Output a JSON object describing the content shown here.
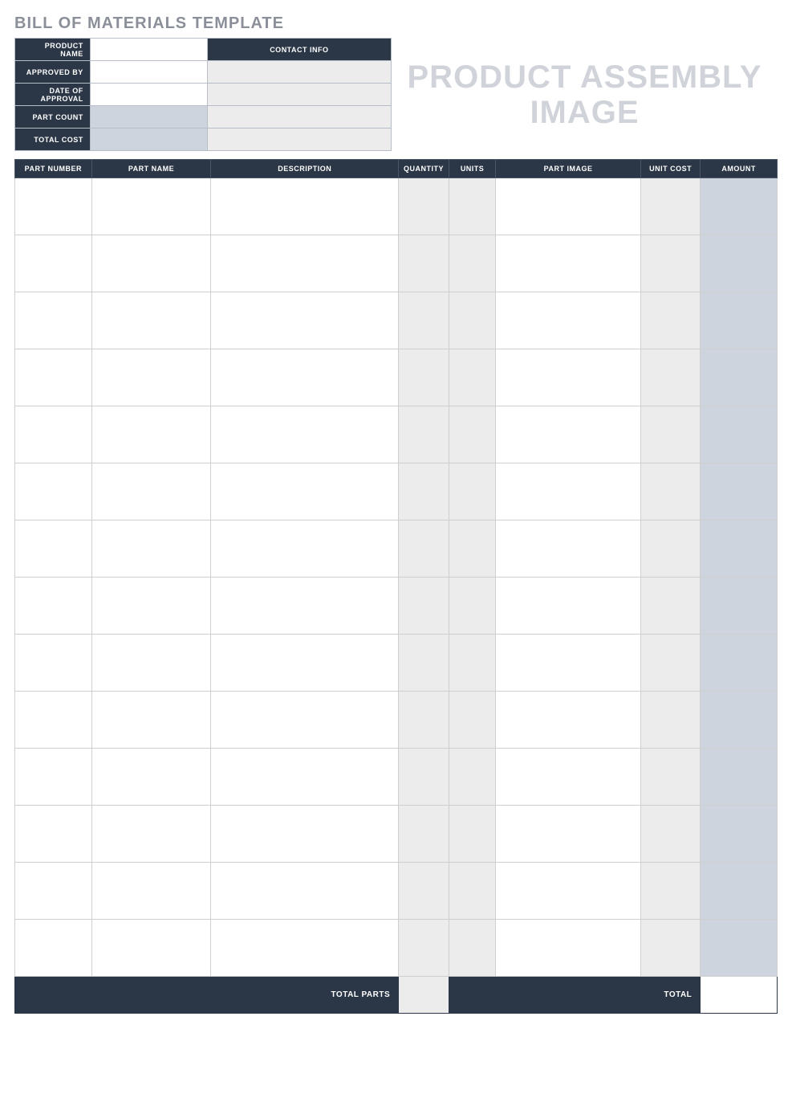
{
  "title": "BILL OF MATERIALS TEMPLATE",
  "info": {
    "product_name_label": "PRODUCT NAME",
    "contact_info_label": "CONTACT INFO",
    "approved_by_label": "APPROVED BY",
    "date_of_approval_label": "DATE OF APPROVAL",
    "part_count_label": "PART COUNT",
    "total_cost_label": "TOTAL COST",
    "product_name": "",
    "approved_by": "",
    "date_of_approval": "",
    "part_count": "",
    "total_cost": "",
    "contact1": "",
    "contact2": "",
    "contact3": "",
    "contact4": ""
  },
  "assembly_placeholder": "PRODUCT ASSEMBLY IMAGE",
  "columns": {
    "part_number": "PART NUMBER",
    "part_name": "PART NAME",
    "description": "DESCRIPTION",
    "quantity": "QUANTITY",
    "units": "UNITS",
    "part_image": "PART IMAGE",
    "unit_cost": "UNIT COST",
    "amount": "AMOUNT"
  },
  "rows": [
    {
      "part_number": "",
      "part_name": "",
      "description": "",
      "quantity": "",
      "units": "",
      "part_image": "",
      "unit_cost": "",
      "amount": ""
    },
    {
      "part_number": "",
      "part_name": "",
      "description": "",
      "quantity": "",
      "units": "",
      "part_image": "",
      "unit_cost": "",
      "amount": ""
    },
    {
      "part_number": "",
      "part_name": "",
      "description": "",
      "quantity": "",
      "units": "",
      "part_image": "",
      "unit_cost": "",
      "amount": ""
    },
    {
      "part_number": "",
      "part_name": "",
      "description": "",
      "quantity": "",
      "units": "",
      "part_image": "",
      "unit_cost": "",
      "amount": ""
    },
    {
      "part_number": "",
      "part_name": "",
      "description": "",
      "quantity": "",
      "units": "",
      "part_image": "",
      "unit_cost": "",
      "amount": ""
    },
    {
      "part_number": "",
      "part_name": "",
      "description": "",
      "quantity": "",
      "units": "",
      "part_image": "",
      "unit_cost": "",
      "amount": ""
    },
    {
      "part_number": "",
      "part_name": "",
      "description": "",
      "quantity": "",
      "units": "",
      "part_image": "",
      "unit_cost": "",
      "amount": ""
    },
    {
      "part_number": "",
      "part_name": "",
      "description": "",
      "quantity": "",
      "units": "",
      "part_image": "",
      "unit_cost": "",
      "amount": ""
    },
    {
      "part_number": "",
      "part_name": "",
      "description": "",
      "quantity": "",
      "units": "",
      "part_image": "",
      "unit_cost": "",
      "amount": ""
    },
    {
      "part_number": "",
      "part_name": "",
      "description": "",
      "quantity": "",
      "units": "",
      "part_image": "",
      "unit_cost": "",
      "amount": ""
    },
    {
      "part_number": "",
      "part_name": "",
      "description": "",
      "quantity": "",
      "units": "",
      "part_image": "",
      "unit_cost": "",
      "amount": ""
    },
    {
      "part_number": "",
      "part_name": "",
      "description": "",
      "quantity": "",
      "units": "",
      "part_image": "",
      "unit_cost": "",
      "amount": ""
    },
    {
      "part_number": "",
      "part_name": "",
      "description": "",
      "quantity": "",
      "units": "",
      "part_image": "",
      "unit_cost": "",
      "amount": ""
    },
    {
      "part_number": "",
      "part_name": "",
      "description": "",
      "quantity": "",
      "units": "",
      "part_image": "",
      "unit_cost": "",
      "amount": ""
    }
  ],
  "footer": {
    "total_parts_label": "TOTAL PARTS",
    "total_label": "TOTAL",
    "total_parts": "",
    "total_amount": ""
  }
}
